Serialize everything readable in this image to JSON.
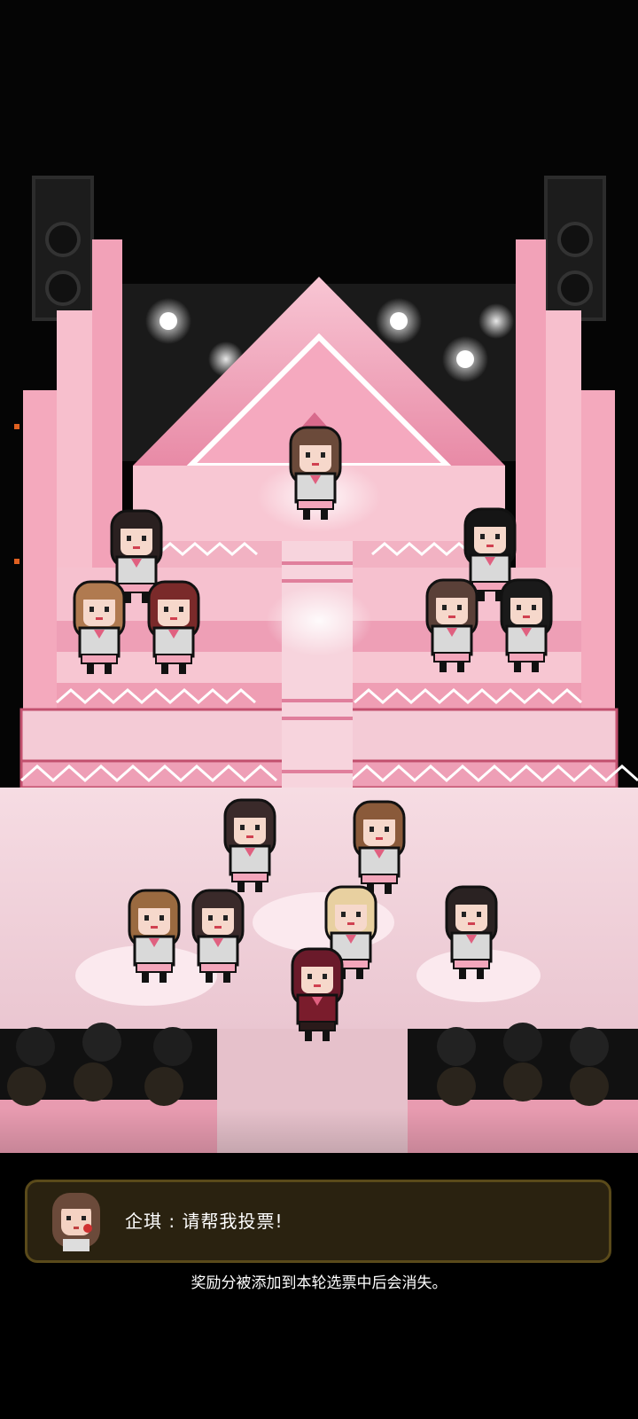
{
  "dialog": {
    "text": "企琪 : 请帮我投票!",
    "avatar_icon": "girl-portrait-icon"
  },
  "hint": {
    "text": "奖励分被添加到本轮选票中后会消失。"
  },
  "colors": {
    "background": "#000000",
    "stage_pink": "#f4b6c8",
    "stage_dark_pink": "#d86a8c",
    "floor": "#f0d6de",
    "dialog_bg": "#2a2210",
    "dialog_border": "#5a4a1a"
  },
  "scene": {
    "characters": [
      {
        "name": "center-idol",
        "hair": "#6b4a3a"
      },
      {
        "name": "idol-left-top",
        "hair": "#2a2020"
      },
      {
        "name": "idol-right-top",
        "hair": "#151515"
      },
      {
        "name": "idol-left-mid-1",
        "hair": "#b07a50"
      },
      {
        "name": "idol-left-mid-2",
        "hair": "#7a2a2a"
      },
      {
        "name": "idol-right-mid-1",
        "hair": "#5a4038"
      },
      {
        "name": "idol-right-mid-2",
        "hair": "#1a1a1a"
      },
      {
        "name": "trainee-1",
        "hair": "#3a2a2a"
      },
      {
        "name": "trainee-2",
        "hair": "#8a5a3a"
      },
      {
        "name": "trainee-3",
        "hair": "#9a6a40"
      },
      {
        "name": "trainee-4",
        "hair": "#3a2a2a"
      },
      {
        "name": "trainee-5",
        "hair": "#e8d0a0"
      },
      {
        "name": "trainee-6",
        "hair": "#2a2222"
      },
      {
        "name": "producer",
        "hair": "#6a1a2a"
      }
    ]
  }
}
